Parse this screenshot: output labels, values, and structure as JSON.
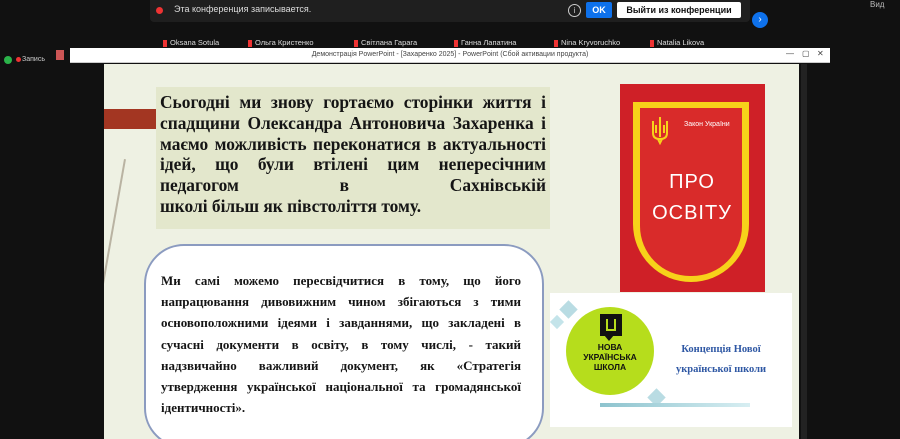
{
  "recording_banner": {
    "text": "Эта конференция записывается.",
    "ok_label": "OK",
    "leave_label": "Выйти из конференции"
  },
  "top_right_label": "Вид",
  "participants": [
    {
      "name": "Oksana Sotula"
    },
    {
      "name": "Ольга Кристенко"
    },
    {
      "name": "Світлана Гарага"
    },
    {
      "name": "Ганна Лапатина"
    },
    {
      "name": "Nina Kryvoruchko"
    },
    {
      "name": "Natalia Likova"
    }
  ],
  "left_status": {
    "recording_label": "Запись"
  },
  "ppt": {
    "title": "Демонстрація PowerPoint - [Захаренко 2025] - PowerPoint (Сбой активации продукта)",
    "minimize": "—",
    "restore": "▢",
    "close": "✕"
  },
  "slide": {
    "quote1_lines": [
      "Сьогодні ми знову гортаємо сторінки життя",
      "і спадщини Олександра Антоновича",
      "Захаренка і маємо можливість переконатися",
      "в актуальності ідей, що були втілені цим",
      "непересічним педагогом в Сахнівській",
      "школі більш як півстоліття тому."
    ],
    "quote2": "Ми самі можемо пересвідчитися в тому, що його напрацювання дивовижним чином збігаються з тими основоположними ідеями і завданнями, що закладені в сучасні документи в освіту, в тому числі, - такий надзвичайно важливий документ, як «Стратегія утвердження української національної та громадянської ідентичності».",
    "law_image": {
      "small_label": "Закон України",
      "big_label": "ПРО ОСВІТУ"
    },
    "nus_image": {
      "logo_text": "НОВА УКРАЇНСЬКА ШКОЛА",
      "title": "Концепція Нової української школи"
    }
  },
  "colors": {
    "accent": "#a33622",
    "slide_bg": "#eef1e3",
    "law_red": "#cf2027",
    "law_yellow": "#f7d21a",
    "nus_green": "#b6dd1c",
    "zoom_blue": "#0e71eb"
  }
}
